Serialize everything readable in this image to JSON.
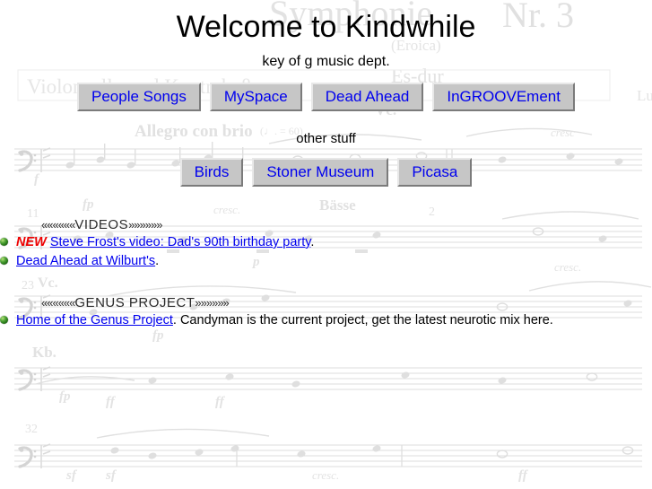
{
  "page": {
    "title": "Welcome to Kindwhile",
    "subtitle": "key of g music dept."
  },
  "nav_primary": {
    "buttons": [
      {
        "label": "People Songs"
      },
      {
        "label": "MySpace"
      },
      {
        "label": "Dead Ahead"
      },
      {
        "label": "InGROOVEment"
      }
    ]
  },
  "other_stuff": {
    "heading": "other stuff",
    "buttons": [
      {
        "label": "Birds"
      },
      {
        "label": "Stoner Museum"
      },
      {
        "label": "Picasa"
      }
    ]
  },
  "videos_section": {
    "guillemets_left": "««««««",
    "heading": "VIDEOS",
    "guillemets_right": "»»»»»»",
    "items": [
      {
        "badge": "NEW",
        "link_text": "Steve Frost's video: Dad's 90th birthday party",
        "suffix": "."
      },
      {
        "badge": "",
        "link_text": "Dead Ahead at Wilburt's",
        "suffix": "."
      }
    ]
  },
  "genus_section": {
    "guillemets_left": "««««««",
    "heading": "GENUS PROJECT",
    "guillemets_right": "»»»»»»",
    "items": [
      {
        "link_text": "Home of the Genus Project",
        "suffix": ". Candyman is the current project, get the latest neurotic mix here."
      }
    ]
  },
  "background": {
    "watermark_type": "sheet-music-score",
    "score_title": "Symphonie",
    "score_number": "Nr. 3",
    "score_nickname": "(Eroica)",
    "score_key": "Es-dur",
    "score_composer": "Lud",
    "score_staff_label_top": "Violoncello und Kontrabaß",
    "score_tempo": "Allegro con brio",
    "score_tempo_metronome": "(♩. = 60)",
    "instrument_labels": [
      "Vc.",
      "Bässe",
      "Vc.",
      "Kb."
    ],
    "measure_numbers": [
      "11",
      "2",
      "23",
      "32"
    ],
    "dynamics": [
      "cresc.",
      "f",
      "ff",
      "fp",
      "p",
      "sf",
      "sf",
      "cresc."
    ]
  },
  "colors": {
    "link": "#0000EE",
    "new_badge": "#EE0000",
    "button_face": "#C6C6C6",
    "bullet_green": "#3E8E28",
    "text": "#000000",
    "watermark": "#D8D8D8"
  }
}
